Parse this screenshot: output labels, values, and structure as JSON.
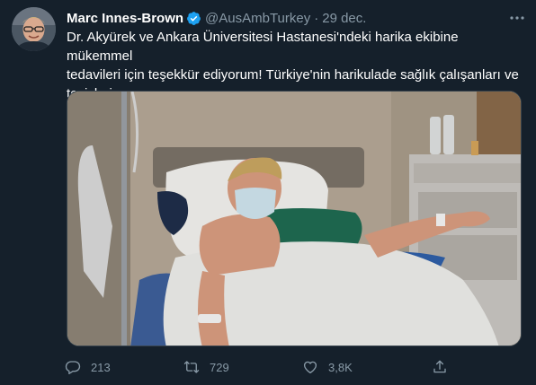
{
  "tweet": {
    "author": {
      "display_name": "Marc Innes-Brown",
      "handle": "@AusAmbTurkey",
      "verified": true,
      "avatar_icon": "avatar"
    },
    "separator": "·",
    "date": "29 dec.",
    "text_lines": [
      "Dr. Akyürek ve Ankara Üniversitesi Hastanesi'ndeki harika ekibine mükemmel",
      "tedavileri için teşekkür ediyorum! Türkiye'nin harikulade sağlık çalışanları ve",
      "tesisleri var."
    ],
    "media": {
      "type": "photo"
    },
    "actions": {
      "reply": {
        "icon": "reply-icon",
        "count": "213"
      },
      "retweet": {
        "icon": "retweet-icon",
        "count": "729"
      },
      "like": {
        "icon": "heart-icon",
        "count": "3,8K"
      },
      "share": {
        "icon": "share-icon"
      }
    }
  },
  "colors": {
    "background": "#15202b",
    "text": "#ffffff",
    "secondary": "#8899a6",
    "verified": "#1da1f2",
    "border": "#38444d"
  }
}
